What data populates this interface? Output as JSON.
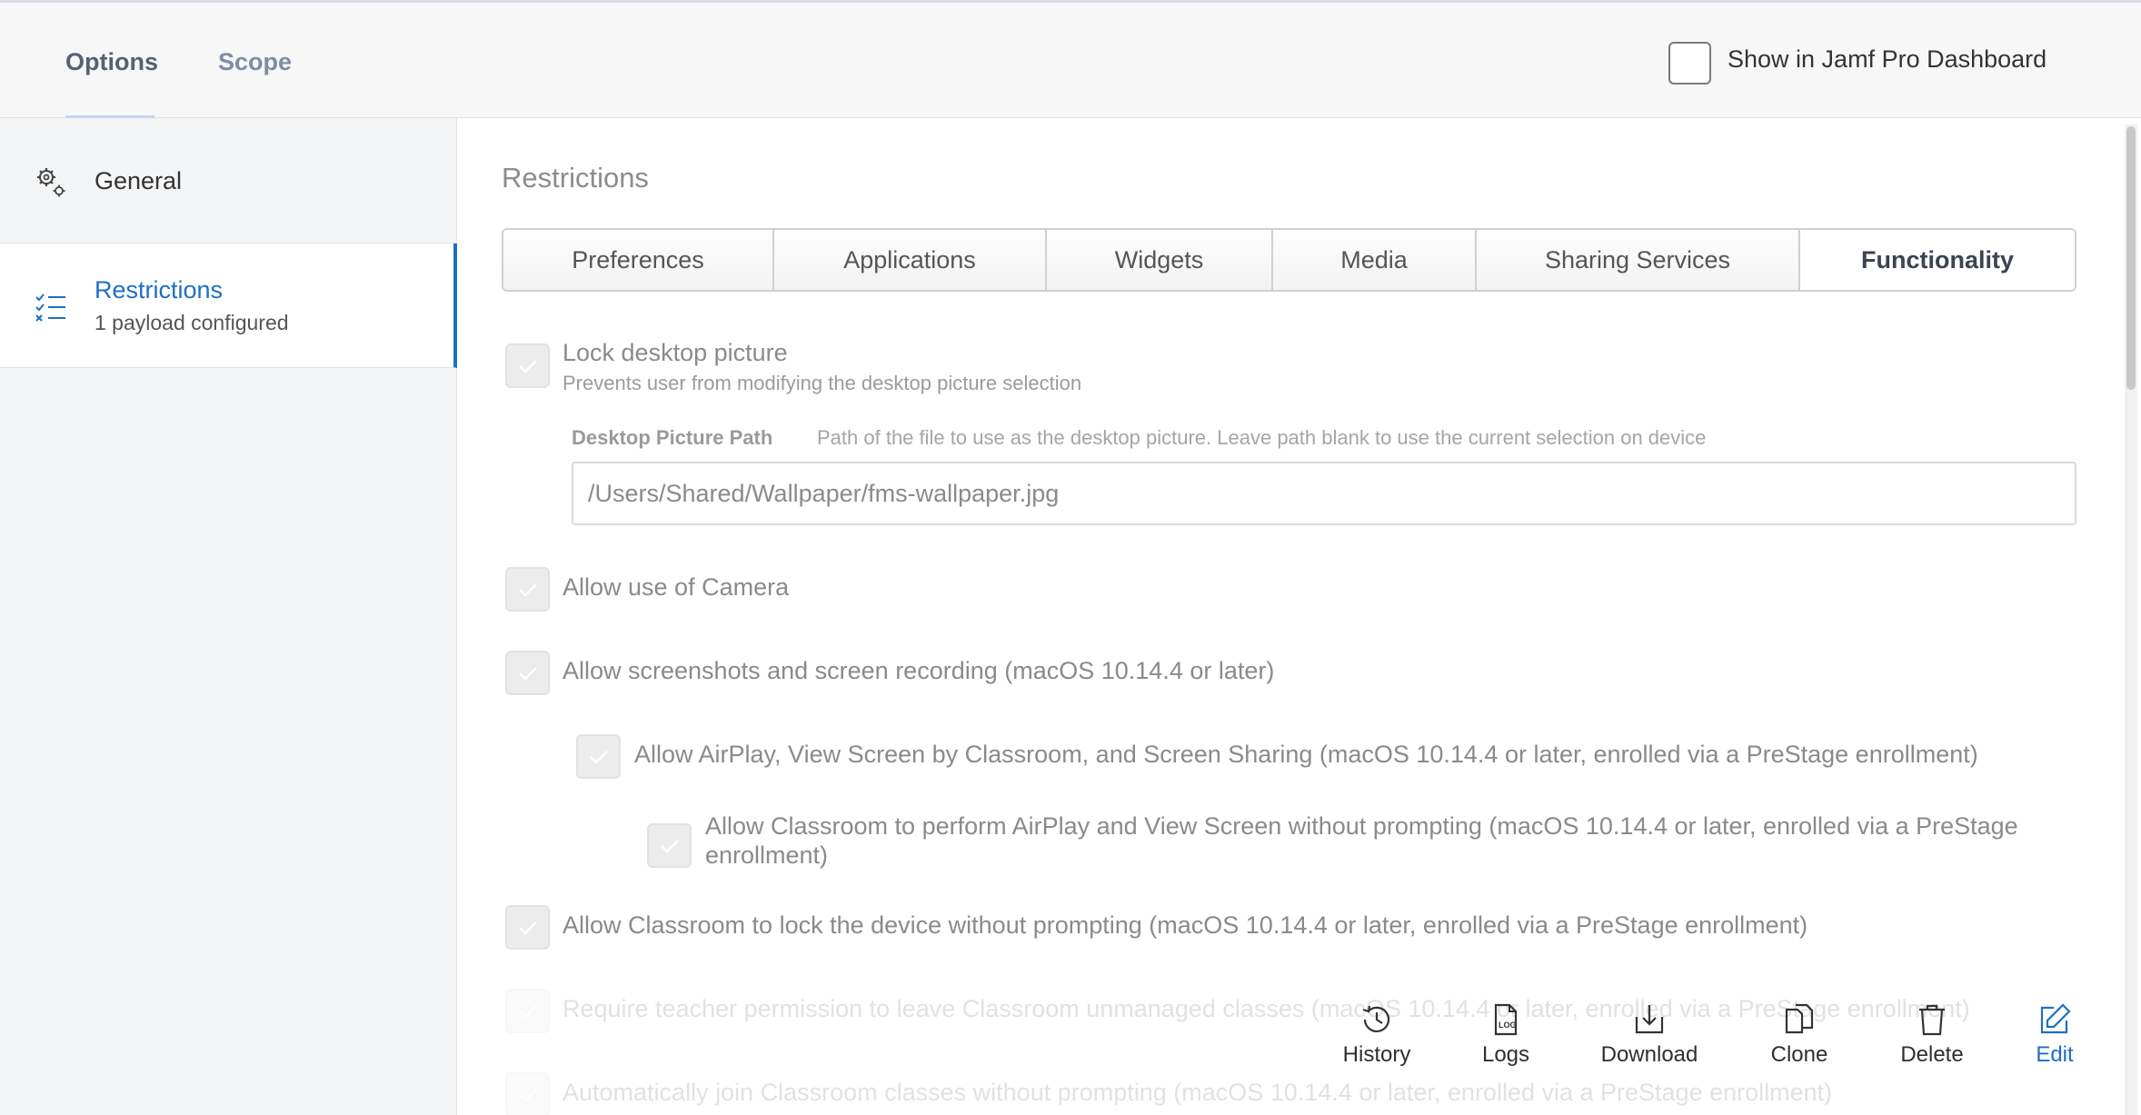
{
  "top_tabs": {
    "options": "Options",
    "scope": "Scope"
  },
  "dashboard": {
    "label": "Show in Jamf Pro Dashboard",
    "checked": false
  },
  "sidebar": {
    "items": [
      {
        "label": "General",
        "icon": "gear-icon"
      },
      {
        "label": "Restrictions",
        "sublabel": "1 payload configured",
        "icon": "checklist-icon",
        "selected": true
      }
    ]
  },
  "main": {
    "section_title": "Restrictions",
    "tabs": [
      "Preferences",
      "Applications",
      "Widgets",
      "Media",
      "Sharing Services",
      "Functionality"
    ],
    "active_tab": "Functionality",
    "options": {
      "lock_desktop": {
        "label": "Lock desktop picture",
        "desc": "Prevents user from modifying the desktop picture selection",
        "checked": true
      },
      "desktop_path": {
        "title": "Desktop Picture Path",
        "desc": "Path of the file to use as the desktop picture. Leave path blank to use the current selection on device",
        "value": "/Users/Shared/Wallpaper/fms-wallpaper.jpg"
      },
      "camera": {
        "label": "Allow use of Camera",
        "checked": true
      },
      "screenshots": {
        "label": "Allow screenshots and screen recording (macOS 10.14.4 or later)",
        "checked": true
      },
      "airplay": {
        "label": "Allow AirPlay, View Screen by Classroom, and Screen Sharing (macOS 10.14.4 or later, enrolled via a PreStage enrollment)",
        "checked": true
      },
      "classroom_airplay": {
        "label": "Allow Classroom to perform AirPlay and View Screen without prompting (macOS 10.14.4 or later, enrolled via a PreStage enrollment)",
        "checked": true
      },
      "classroom_lock": {
        "label": "Allow Classroom to lock the device without prompting (macOS 10.14.4 or later, enrolled via a PreStage enrollment)",
        "checked": true
      },
      "teacher_permission": {
        "label": "Require teacher permission to leave Classroom unmanaged classes (macOS 10.14.4 or later, enrolled via a PreStage enrollment)",
        "checked": true
      },
      "auto_join": {
        "label": "Automatically join Classroom classes without prompting (macOS 10.14.4 or later, enrolled via a PreStage enrollment)",
        "checked": true
      }
    }
  },
  "actions": {
    "history": {
      "label": "History",
      "icon": "history-icon"
    },
    "logs": {
      "label": "Logs",
      "icon": "logs-icon"
    },
    "download": {
      "label": "Download",
      "icon": "download-icon"
    },
    "clone": {
      "label": "Clone",
      "icon": "clone-icon"
    },
    "delete": {
      "label": "Delete",
      "icon": "trash-icon"
    },
    "edit": {
      "label": "Edit",
      "icon": "edit-icon"
    }
  },
  "colors": {
    "accent": "#1f6ec6",
    "tab_underline": "#c5d6ef",
    "sidebar_bg": "#f4f5f7"
  }
}
